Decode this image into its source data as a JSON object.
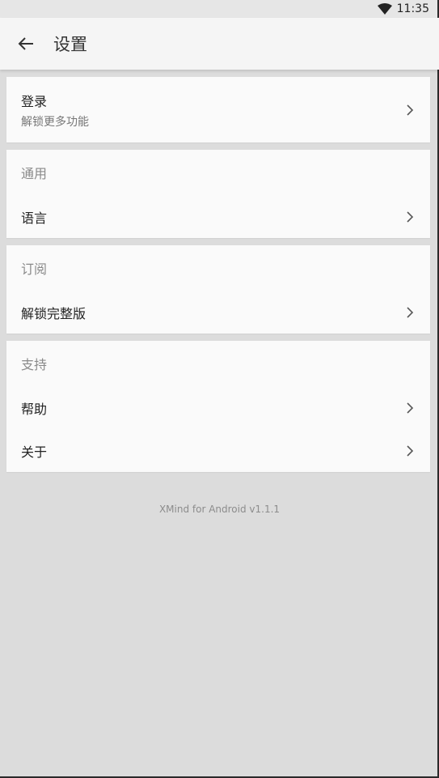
{
  "status_bar": {
    "time": "11:35",
    "wifi_icon": "wifi-icon"
  },
  "app_bar": {
    "title": "设置",
    "back_icon": "arrow-back-icon"
  },
  "login": {
    "title": "登录",
    "subtitle": "解锁更多功能"
  },
  "sections": {
    "general": {
      "header": "通用",
      "language": "语言"
    },
    "subscription": {
      "header": "订阅",
      "unlock_full": "解锁完整版"
    },
    "support": {
      "header": "支持",
      "help": "帮助",
      "about": "关于"
    }
  },
  "footer": {
    "version": "XMind for Android v1.1.1"
  },
  "colors": {
    "background": "#dcdcdc",
    "card": "#fafafa",
    "app_bar": "#f5f5f5",
    "header_text": "#8a8a8a"
  }
}
